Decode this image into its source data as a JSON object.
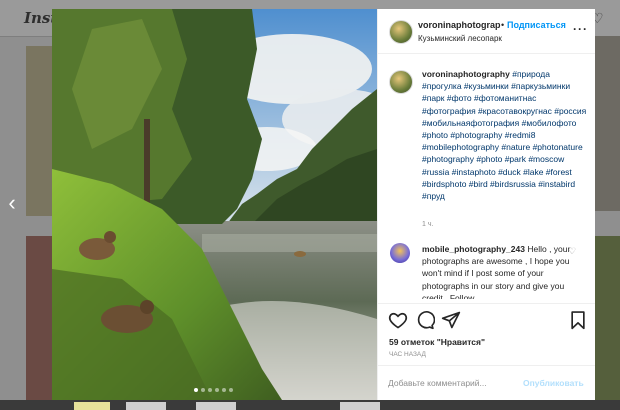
{
  "background": {
    "logo": "Insta"
  },
  "post": {
    "username": "voroninaphotography",
    "header_username": "voroninaphotograp",
    "follow_label": "Подписаться",
    "location": "Кузьминский лесопарк",
    "caption_tags": "#природа #прогулка #кузьминки #паркузьминки #парк #фото #фотоманитнас #фотография #красотавокругнас #россия #мобильнаяфотография #мобилофото #photo #photography #redmi8 #mobilephotography #nature #photonature #photography #photo #park #moscow #russia #instaphoto #duck #lake #forest #birdsphoto #bird #birdsrussia #instabird #пруд",
    "caption_time": "1 ч.",
    "comment": {
      "username": "mobile_photography_243",
      "text": "Hello , your photographs are awesome , I hope you won't mind if I post some of your photographs in our story and give you credit . Follow"
    },
    "likes": "59 отметок \"Нравится\"",
    "posted_ago": "час назад",
    "add_comment_placeholder": "Добавьте комментарий...",
    "publish_label": "Опубликовать"
  },
  "icons": [
    "heart-icon",
    "comment-icon",
    "share-icon",
    "bookmark-icon",
    "more-icon",
    "chevron-left-icon"
  ],
  "colors": {
    "link": "#0095f6",
    "hashtag": "#00376b",
    "muted": "#8e8e8e"
  }
}
